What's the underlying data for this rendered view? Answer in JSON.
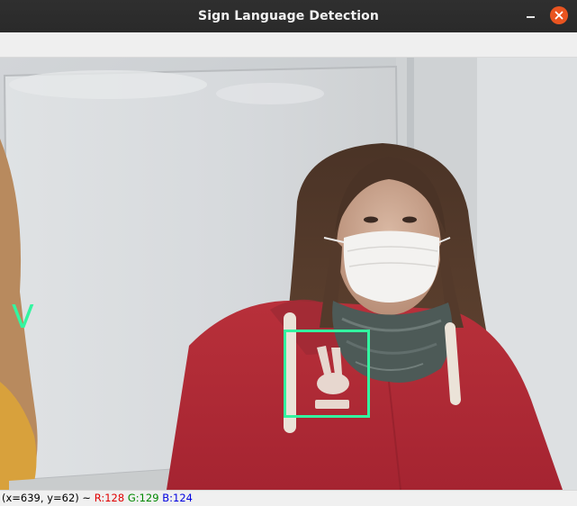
{
  "window": {
    "title": "Sign Language Detection",
    "accent_close": "#e95420"
  },
  "detection": {
    "label": "V",
    "box_color": "#33f5a0"
  },
  "status": {
    "coords": "(x=639, y=62) ~ ",
    "r": "R:128",
    "g": "G:129",
    "b": "B:124"
  }
}
